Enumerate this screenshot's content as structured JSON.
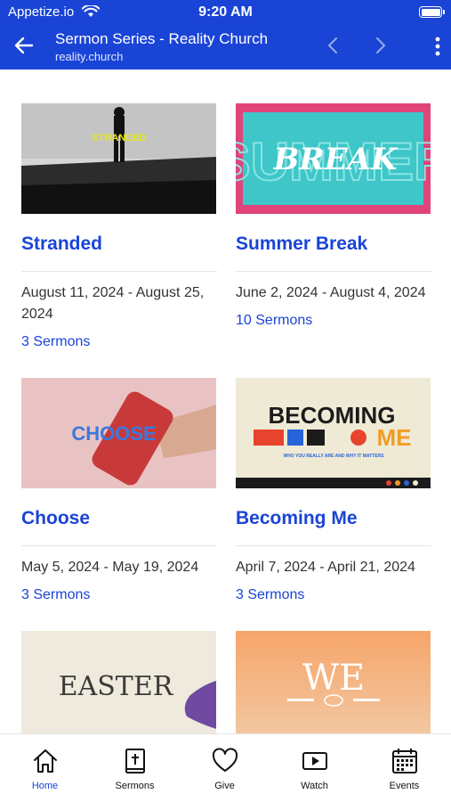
{
  "status_bar": {
    "carrier": "Appetize.io",
    "time": "9:20 AM"
  },
  "header": {
    "title": "Sermon Series - Reality Church",
    "subtitle": "reality.church"
  },
  "series": [
    {
      "title": "Stranded",
      "dates": "August 11, 2024 - August 25, 2024",
      "count": "3 Sermons",
      "thumb_text": "STRANDED"
    },
    {
      "title": "Summer Break",
      "dates": "June 2, 2024 - August 4, 2024",
      "count": "10 Sermons",
      "thumb_text": "BREAK"
    },
    {
      "title": "Choose",
      "dates": "May 5, 2024 - May 19, 2024",
      "count": "3 Sermons",
      "thumb_text": "CHOOSE"
    },
    {
      "title": "Becoming Me",
      "dates": "April 7, 2024 - April 21, 2024",
      "count": "3 Sermons",
      "thumb_text_1": "BECOMING",
      "thumb_text_2": "ME",
      "thumb_tagline": "WHO YOU REALLY ARE AND WHY IT MATTERS"
    },
    {
      "thumb_text": "EASTER"
    },
    {
      "thumb_text": "WE"
    }
  ],
  "tabs": [
    {
      "label": "Home",
      "icon": "home-icon",
      "active": true
    },
    {
      "label": "Sermons",
      "icon": "bible-icon",
      "active": false
    },
    {
      "label": "Give",
      "icon": "heart-icon",
      "active": false
    },
    {
      "label": "Watch",
      "icon": "video-icon",
      "active": false
    },
    {
      "label": "Events",
      "icon": "calendar-icon",
      "active": false
    }
  ],
  "colors": {
    "brand": "#1a44d6",
    "active_tab": "#1a44d6",
    "text": "#333333"
  }
}
